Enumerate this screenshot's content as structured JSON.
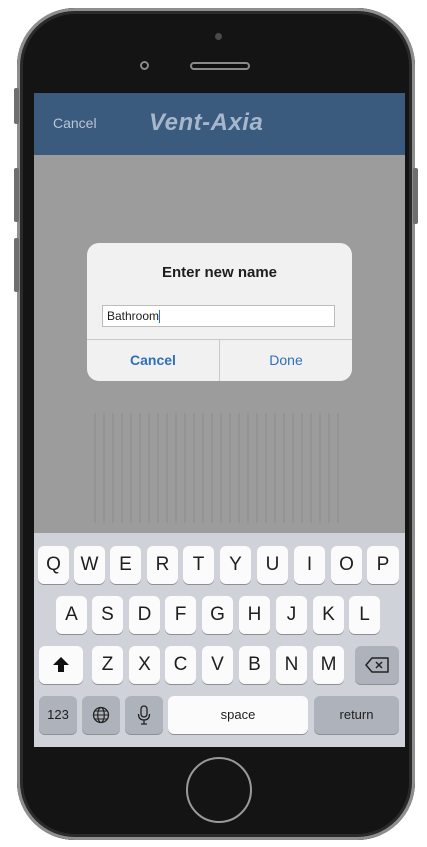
{
  "navbar": {
    "cancel_label": "Cancel",
    "logo_text": "Vent-Axia"
  },
  "alert": {
    "title": "Enter new name",
    "input_value": "Bathroom",
    "cancel_label": "Cancel",
    "done_label": "Done"
  },
  "keyboard": {
    "row1": [
      "Q",
      "W",
      "E",
      "R",
      "T",
      "Y",
      "U",
      "I",
      "O",
      "P"
    ],
    "row2": [
      "A",
      "S",
      "D",
      "F",
      "G",
      "H",
      "J",
      "K",
      "L"
    ],
    "row3": [
      "Z",
      "X",
      "C",
      "V",
      "B",
      "N",
      "M"
    ],
    "numbers_label": "123",
    "space_label": "space",
    "return_label": "return",
    "shift_icon": "shift-arrow-icon",
    "delete_icon": "backspace-icon",
    "globe_icon": "globe-icon",
    "mic_icon": "microphone-icon"
  },
  "colors": {
    "navbar": "#3a5a7e",
    "link": "#2f6fbe",
    "keyboard_bg": "#cfd2d8"
  }
}
